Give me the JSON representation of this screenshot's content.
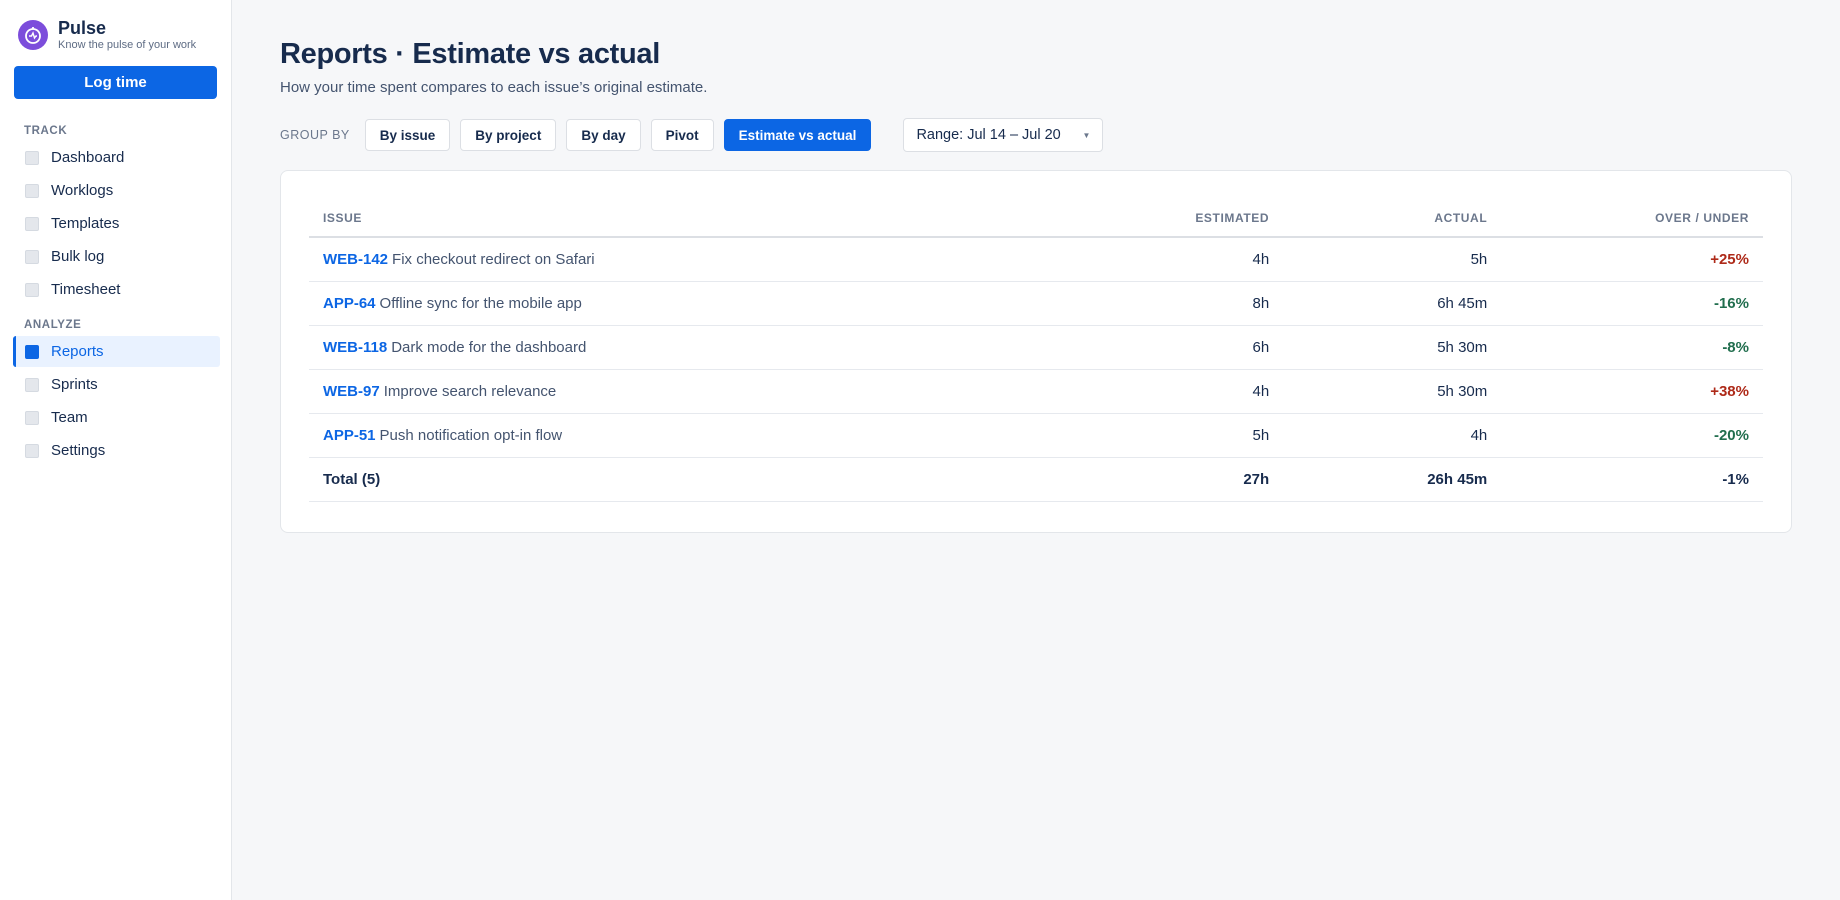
{
  "brand": {
    "name": "Pulse",
    "tagline": "Know the pulse of your work",
    "logo_icon": "pulse-icon",
    "logo_color": "#7c4ddb"
  },
  "actions": {
    "log_time": "Log time"
  },
  "nav": {
    "track_heading": "TRACK",
    "track_items": [
      {
        "label": "Dashboard"
      },
      {
        "label": "Worklogs"
      },
      {
        "label": "Templates"
      },
      {
        "label": "Bulk log"
      },
      {
        "label": "Timesheet"
      }
    ],
    "analyze_heading": "ANALYZE",
    "analyze_items": [
      {
        "label": "Reports",
        "active": true
      },
      {
        "label": "Sprints"
      },
      {
        "label": "Team"
      },
      {
        "label": "Settings"
      }
    ]
  },
  "page": {
    "title": "Reports · Estimate vs actual",
    "subtitle": "How your time spent compares to each issue’s original estimate."
  },
  "toolbar": {
    "group_by_label": "GROUP BY",
    "buttons": [
      {
        "label": "By issue"
      },
      {
        "label": "By project"
      },
      {
        "label": "By day"
      },
      {
        "label": "Pivot"
      },
      {
        "label": "Estimate vs actual",
        "active": true
      }
    ],
    "range_value": "Range: Jul 14 – Jul 20"
  },
  "table": {
    "headers": {
      "issue": "ISSUE",
      "estimated": "ESTIMATED",
      "actual": "ACTUAL",
      "over_under": "OVER / UNDER"
    },
    "rows": [
      {
        "key": "WEB-142",
        "title": "Fix checkout redirect on Safari",
        "estimated": "4h",
        "actual": "5h",
        "diff": "+25%",
        "status": "over"
      },
      {
        "key": "APP-64",
        "title": "Offline sync for the mobile app",
        "estimated": "8h",
        "actual": "6h 45m",
        "diff": "-16%",
        "status": "under"
      },
      {
        "key": "WEB-118",
        "title": "Dark mode for the dashboard",
        "estimated": "6h",
        "actual": "5h 30m",
        "diff": "-8%",
        "status": "under"
      },
      {
        "key": "WEB-97",
        "title": "Improve search relevance",
        "estimated": "4h",
        "actual": "5h 30m",
        "diff": "+38%",
        "status": "over"
      },
      {
        "key": "APP-51",
        "title": "Push notification opt-in flow",
        "estimated": "5h",
        "actual": "4h",
        "diff": "-20%",
        "status": "under"
      }
    ],
    "total": {
      "label": "Total (5)",
      "estimated": "27h",
      "actual": "26h 45m",
      "diff": "-1%",
      "status": "under"
    }
  },
  "colors": {
    "accent": "#0c66e4",
    "over": "#ae2a19",
    "under": "#216e4e"
  }
}
